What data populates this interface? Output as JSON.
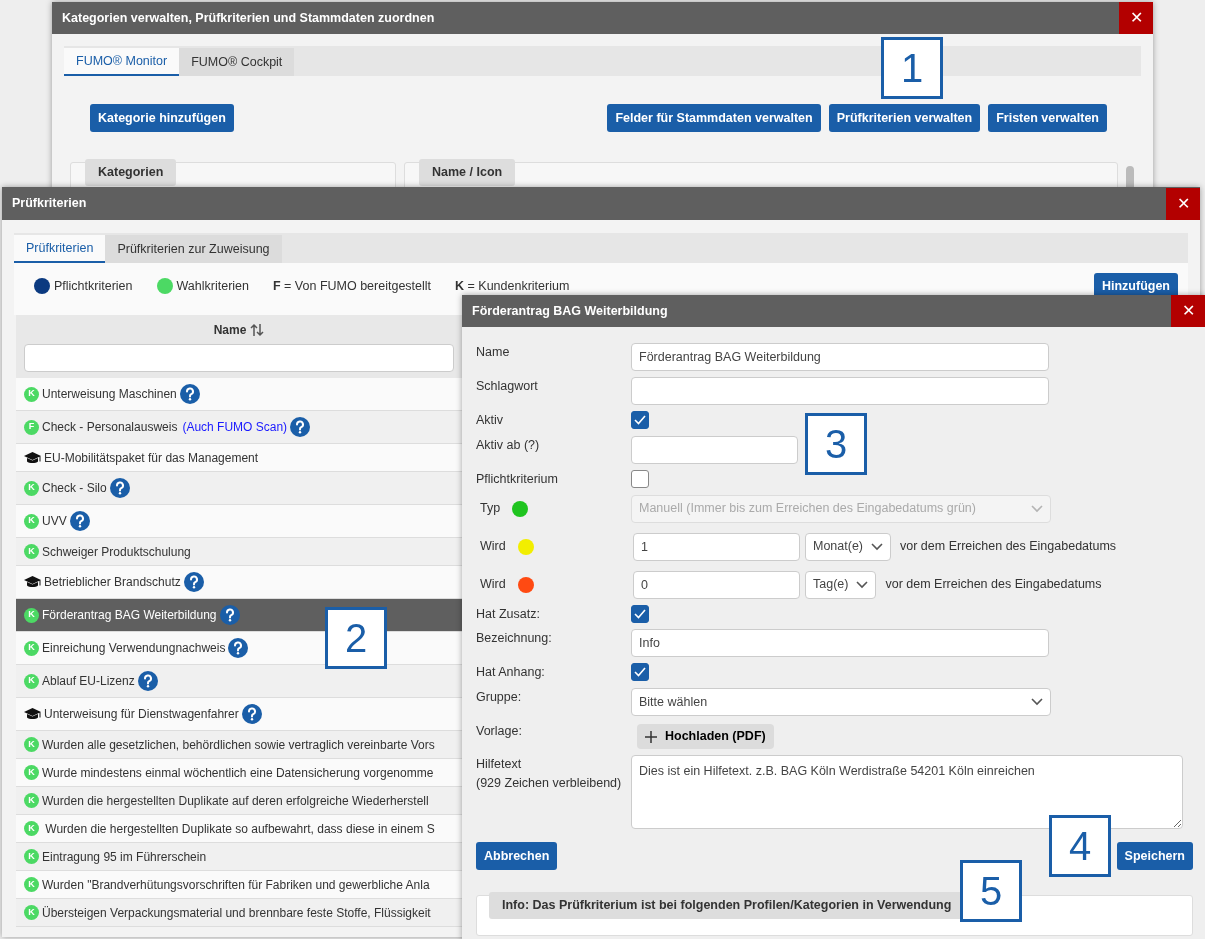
{
  "main_window": {
    "title": "Kategorien verwalten, Prüfkriterien und Stammdaten zuordnen",
    "close": "✕",
    "tabs": [
      {
        "label": "FUMO® Monitor",
        "selected": true
      },
      {
        "label": "FUMO® Cockpit",
        "selected": false
      }
    ],
    "left_buttons": [
      "Kategorie hinzufügen"
    ],
    "right_buttons": [
      "Felder für Stammdaten verwalten",
      "Prüfkriterien verwalten",
      "Fristen verwalten"
    ],
    "panels": [
      "Kategorien",
      "Name / Icon"
    ]
  },
  "criteria_window": {
    "title": "Prüfkriterien",
    "close": "✕",
    "tabs": [
      {
        "label": "Prüfkriterien",
        "selected": true
      },
      {
        "label": "Prüfkriterien zur Zuweisung",
        "selected": false
      }
    ],
    "legend": [
      {
        "kind": "dot",
        "color": "#0b3a80",
        "label": "Pflichtkriterien"
      },
      {
        "kind": "dot",
        "color": "#4cd964",
        "label": "Wahlkriterien"
      },
      {
        "kind": "key",
        "key": "F",
        "label": "= Von FUMO bereitgestellt"
      },
      {
        "kind": "key",
        "key": "K",
        "label": "= Kundenkriterium"
      }
    ],
    "add_button": "Hinzufügen",
    "table": {
      "column": "Name",
      "rows": [
        {
          "kind": "badge",
          "badge": "K",
          "text": "Unterweisung Maschinen",
          "help": true,
          "selected": false
        },
        {
          "kind": "badge",
          "badge": "F",
          "text": "Check - Personalausweis",
          "link": "(Auch FUMO Scan)",
          "help": true,
          "selected": false
        },
        {
          "kind": "course",
          "text": "EU-Mobilitätspaket für das Management",
          "help": false,
          "selected": false
        },
        {
          "kind": "badge",
          "badge": "K",
          "text": "Check - Silo",
          "help": true,
          "selected": false
        },
        {
          "kind": "badge",
          "badge": "K",
          "text": "UVV",
          "help": true,
          "selected": false
        },
        {
          "kind": "badge",
          "badge": "K",
          "text": "Schweiger Produktschulung",
          "help": false,
          "selected": false
        },
        {
          "kind": "course",
          "text": "Betrieblicher Brandschutz",
          "help": true,
          "selected": false
        },
        {
          "kind": "badge",
          "badge": "K",
          "text": "Förderantrag BAG Weiterbildung",
          "help": true,
          "selected": true
        },
        {
          "kind": "badge",
          "badge": "K",
          "text": "Einreichung Verwendungnachweis",
          "help": true,
          "selected": false
        },
        {
          "kind": "badge",
          "badge": "K",
          "text": "Ablauf EU-Lizenz",
          "help": true,
          "selected": false
        },
        {
          "kind": "course",
          "text": "Unterweisung für Dienstwagenfahrer",
          "help": true,
          "selected": false
        },
        {
          "kind": "badge",
          "badge": "K",
          "text": "Wurden alle gesetzlichen, behördlichen sowie vertraglich vereinbarte Vors",
          "help": false,
          "selected": false
        },
        {
          "kind": "badge",
          "badge": "K",
          "text": "Wurde mindestens einmal wöchentlich eine Datensicherung vorgenomme",
          "help": false,
          "selected": false
        },
        {
          "kind": "badge",
          "badge": "K",
          "text": "Wurden die hergestellten Duplikate auf deren erfolgreiche Wiederherstell",
          "help": false,
          "selected": false
        },
        {
          "kind": "badge",
          "badge": "K",
          "text": " Wurden die hergestellten Duplikate so aufbewahrt, dass diese in einem S",
          "help": false,
          "selected": false
        },
        {
          "kind": "badge",
          "badge": "K",
          "text": "Eintragung 95 im Führerschein",
          "help": false,
          "selected": false
        },
        {
          "kind": "badge",
          "badge": "K",
          "text": "Wurden \"Brandverhütungsvorschriften für Fabriken und gewerbliche Anla",
          "help": false,
          "selected": false
        },
        {
          "kind": "badge",
          "badge": "K",
          "text": "Übersteigen Verpackungsmaterial und brennbare feste Stoffe, Flüssigkeit",
          "help": false,
          "selected": false
        }
      ]
    }
  },
  "edit_dialog": {
    "title": "Förderantrag BAG Weiterbildung",
    "close": "✕",
    "fields": [
      {
        "kind": "text",
        "label": "Name",
        "value": "Förderantrag BAG Weiterbildung"
      },
      {
        "kind": "text",
        "label": "Schlagwort"
      },
      {
        "kind": "checkbox",
        "label": "Aktiv",
        "checked": true
      },
      {
        "kind": "short",
        "label": "Aktiv ab (?)"
      },
      {
        "kind": "checkbox",
        "label": "Pflichtkriterium",
        "checked": false
      },
      {
        "kind": "select",
        "label": "Typ",
        "color": "#1fc41f",
        "value": "Manuell (Immer bis zum Erreichen des Eingabedatums grün)",
        "disabled": true
      },
      {
        "kind": "period",
        "label": "Wird",
        "color": "#f2ee00",
        "value": "1",
        "unit": "Monat(e)",
        "note": "vor dem Erreichen des Eingabedatums"
      },
      {
        "kind": "period",
        "label": "Wird",
        "color": "#ff4a12",
        "value": "0",
        "unit": "Tag(e)",
        "note": "vor dem Erreichen des Eingabedatums"
      },
      {
        "kind": "checkbox",
        "label": "Hat Zusatz:",
        "checked": true
      },
      {
        "kind": "text",
        "label": "Bezeichnung:",
        "value": "Info"
      },
      {
        "kind": "checkbox",
        "label": "Hat Anhang:",
        "checked": true
      },
      {
        "kind": "select",
        "label": "Gruppe:",
        "value": "Bitte wählen",
        "disabled": false
      },
      {
        "kind": "upload",
        "label": "Vorlage:",
        "value": "Hochladen (PDF)"
      },
      {
        "kind": "textarea",
        "label": "Hilfetext",
        "sublabel": "(929 Zeichen verbleibend)",
        "value": "Dies ist ein Hilfetext. z.B. BAG Köln Werdistraße 54201 Köln einreichen"
      }
    ],
    "cancel": "Abbrechen",
    "save": "Speichern",
    "info": "Info: Das Prüfkriterium ist bei folgenden Profilen/Kategorien in Verwendung"
  },
  "callouts": [
    "1",
    "2",
    "3",
    "4",
    "5"
  ]
}
